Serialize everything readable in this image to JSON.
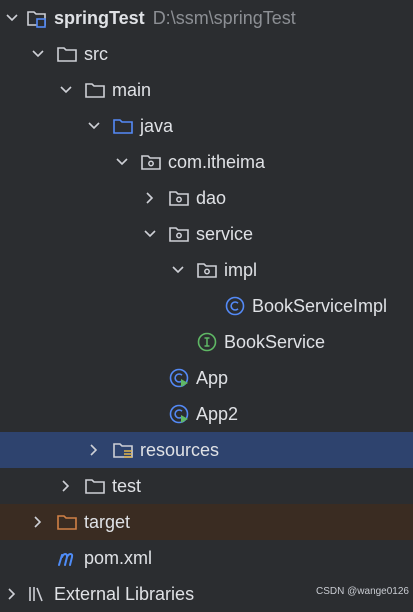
{
  "tree": {
    "project": {
      "name": "springTest",
      "path": "D:\\ssm\\springTest"
    },
    "src": "src",
    "main": "main",
    "java": "java",
    "package": "com.itheima",
    "dao": "dao",
    "service": "service",
    "impl": "impl",
    "book_service_impl": "BookServiceImpl",
    "book_service": "BookService",
    "app": "App",
    "app2": "App2",
    "resources": "resources",
    "test": "test",
    "target": "target",
    "pom": "pom.xml",
    "external_libraries": "External Libraries"
  },
  "colors": {
    "background": "#2b2d30",
    "selected_row": "#2e436e",
    "excluded_row": "#3a2c22",
    "folder": "#ced0d6",
    "source_folder": "#548af7",
    "target_folder": "#d08046",
    "class_icon": "#548af7",
    "interface_icon": "#5fb865",
    "maven_icon": "#4f8cf7"
  },
  "watermark": "CSDN @wange0126"
}
